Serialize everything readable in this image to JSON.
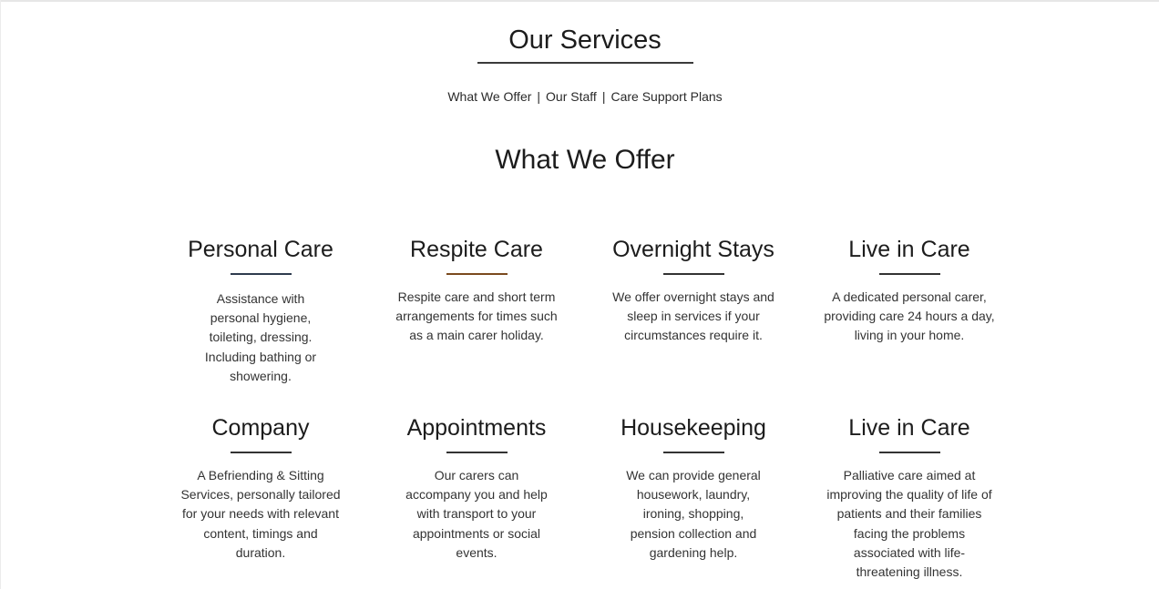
{
  "header": {
    "title": "Our Services",
    "nav": [
      {
        "label": "What We Offer"
      },
      {
        "label": "Our Staff"
      },
      {
        "label": "Care Support Plans"
      }
    ],
    "separator": "|"
  },
  "section": {
    "title": "What We Offer"
  },
  "services": [
    {
      "title": "Personal Care",
      "text": "Assistance with personal hygiene, toileting, dressing. Including bathing or showering."
    },
    {
      "title": "Respite Care",
      "text": "Respite care and short term arrangements for times such as a main carer holiday."
    },
    {
      "title": "Overnight Stays",
      "text": "We offer overnight stays and sleep in services if your circumstances require it."
    },
    {
      "title": "Live in Care",
      "text": "A dedicated personal carer, providing care 24 hours a day, living in your home."
    },
    {
      "title": "Company",
      "text": "A Befriending & Sitting Services, personally tailored for your needs with relevant content, timings and duration."
    },
    {
      "title": "Appointments",
      "text": "Our carers can accompany you and help with transport to your appointments or social events."
    },
    {
      "title": "Housekeeping",
      "text": "We can provide general housework, laundry, ironing, shopping, pension collection and gardening help."
    },
    {
      "title": "Live in Care",
      "text": "Palliative care aimed at improving the quality of life of patients and their families facing the problems associated with life-threatening illness."
    }
  ],
  "colors": {
    "underline_blue": "#2e3b4e",
    "underline_brown": "#7a4a1e",
    "text": "#333333"
  }
}
